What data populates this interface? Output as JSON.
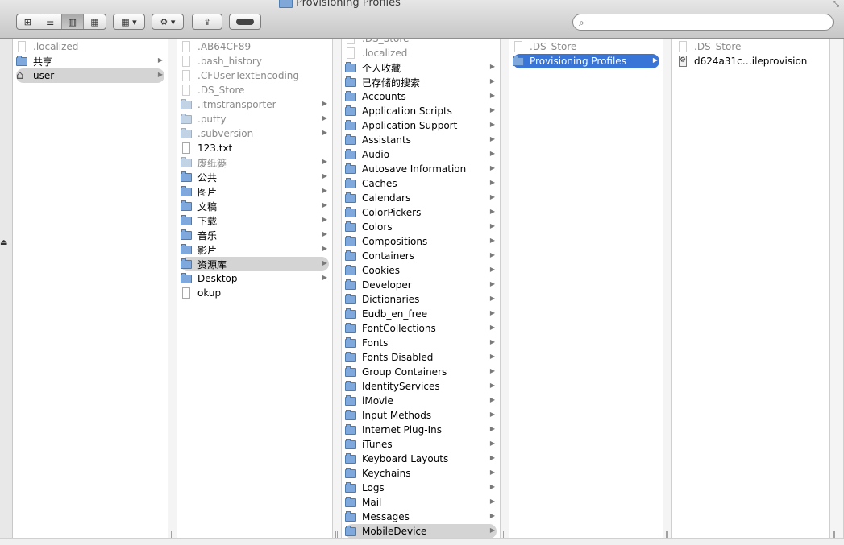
{
  "window": {
    "title": "Provisioning Profiles"
  },
  "toolbar": {
    "view_modes": [
      "icon-view",
      "list-view",
      "column-view",
      "coverflow-view"
    ],
    "active_view": 2,
    "search_placeholder": ""
  },
  "columns": [
    {
      "items": [
        {
          "label": ".localized",
          "kind": "doc",
          "dim": true,
          "arrow": false
        },
        {
          "label": "共享",
          "kind": "folder",
          "dim": false,
          "arrow": true
        },
        {
          "label": "user",
          "kind": "home",
          "dim": false,
          "arrow": true,
          "selected": "gray"
        }
      ]
    },
    {
      "items": [
        {
          "label": ".AB64CF89",
          "kind": "doc",
          "dim": true,
          "arrow": false
        },
        {
          "label": ".bash_history",
          "kind": "doc",
          "dim": true,
          "arrow": false
        },
        {
          "label": ".CFUserTextEncoding",
          "kind": "doc",
          "dim": true,
          "arrow": false
        },
        {
          "label": ".DS_Store",
          "kind": "doc",
          "dim": true,
          "arrow": false
        },
        {
          "label": ".itmstransporter",
          "kind": "folder",
          "dim": true,
          "arrow": true
        },
        {
          "label": ".putty",
          "kind": "folder",
          "dim": true,
          "arrow": true
        },
        {
          "label": ".subversion",
          "kind": "folder",
          "dim": true,
          "arrow": true
        },
        {
          "label": "123.txt",
          "kind": "doc",
          "dim": false,
          "arrow": false
        },
        {
          "label": "废纸篓",
          "kind": "folder",
          "dim": true,
          "arrow": true
        },
        {
          "label": "公共",
          "kind": "folder",
          "dim": false,
          "arrow": true
        },
        {
          "label": "图片",
          "kind": "folder",
          "dim": false,
          "arrow": true
        },
        {
          "label": "文稿",
          "kind": "folder",
          "dim": false,
          "arrow": true
        },
        {
          "label": "下载",
          "kind": "folder",
          "dim": false,
          "arrow": true
        },
        {
          "label": "音乐",
          "kind": "folder",
          "dim": false,
          "arrow": true
        },
        {
          "label": "影片",
          "kind": "folder",
          "dim": false,
          "arrow": true
        },
        {
          "label": "资源库",
          "kind": "folder",
          "dim": false,
          "arrow": true,
          "selected": "gray"
        },
        {
          "label": "Desktop",
          "kind": "folder",
          "dim": false,
          "arrow": true
        },
        {
          "label": "okup",
          "kind": "doc",
          "dim": false,
          "arrow": false
        }
      ]
    },
    {
      "items": [
        {
          "label": ".DS_Store",
          "kind": "doc",
          "dim": true,
          "arrow": false
        },
        {
          "label": ".localized",
          "kind": "doc",
          "dim": true,
          "arrow": false
        },
        {
          "label": "个人收藏",
          "kind": "folder",
          "dim": false,
          "arrow": true
        },
        {
          "label": "已存储的搜索",
          "kind": "folder",
          "dim": false,
          "arrow": true
        },
        {
          "label": "Accounts",
          "kind": "folder",
          "dim": false,
          "arrow": true
        },
        {
          "label": "Application Scripts",
          "kind": "folder",
          "dim": false,
          "arrow": true
        },
        {
          "label": "Application Support",
          "kind": "folder",
          "dim": false,
          "arrow": true
        },
        {
          "label": "Assistants",
          "kind": "folder",
          "dim": false,
          "arrow": true
        },
        {
          "label": "Audio",
          "kind": "folder",
          "dim": false,
          "arrow": true
        },
        {
          "label": "Autosave Information",
          "kind": "folder",
          "dim": false,
          "arrow": true
        },
        {
          "label": "Caches",
          "kind": "folder",
          "dim": false,
          "arrow": true
        },
        {
          "label": "Calendars",
          "kind": "folder",
          "dim": false,
          "arrow": true
        },
        {
          "label": "ColorPickers",
          "kind": "folder",
          "dim": false,
          "arrow": true
        },
        {
          "label": "Colors",
          "kind": "folder",
          "dim": false,
          "arrow": true
        },
        {
          "label": "Compositions",
          "kind": "folder",
          "dim": false,
          "arrow": true
        },
        {
          "label": "Containers",
          "kind": "folder",
          "dim": false,
          "arrow": true
        },
        {
          "label": "Cookies",
          "kind": "folder",
          "dim": false,
          "arrow": true
        },
        {
          "label": "Developer",
          "kind": "folder",
          "dim": false,
          "arrow": true
        },
        {
          "label": "Dictionaries",
          "kind": "folder",
          "dim": false,
          "arrow": true
        },
        {
          "label": "Eudb_en_free",
          "kind": "folder",
          "dim": false,
          "arrow": true
        },
        {
          "label": "FontCollections",
          "kind": "folder",
          "dim": false,
          "arrow": true
        },
        {
          "label": "Fonts",
          "kind": "folder",
          "dim": false,
          "arrow": true
        },
        {
          "label": "Fonts Disabled",
          "kind": "folder",
          "dim": false,
          "arrow": true
        },
        {
          "label": "Group Containers",
          "kind": "folder",
          "dim": false,
          "arrow": true
        },
        {
          "label": "IdentityServices",
          "kind": "folder",
          "dim": false,
          "arrow": true
        },
        {
          "label": "iMovie",
          "kind": "folder",
          "dim": false,
          "arrow": true
        },
        {
          "label": "Input Methods",
          "kind": "folder",
          "dim": false,
          "arrow": true
        },
        {
          "label": "Internet Plug-Ins",
          "kind": "folder",
          "dim": false,
          "arrow": true
        },
        {
          "label": "iTunes",
          "kind": "folder",
          "dim": false,
          "arrow": true
        },
        {
          "label": "Keyboard Layouts",
          "kind": "folder",
          "dim": false,
          "arrow": true
        },
        {
          "label": "Keychains",
          "kind": "folder",
          "dim": false,
          "arrow": true
        },
        {
          "label": "Logs",
          "kind": "folder",
          "dim": false,
          "arrow": true
        },
        {
          "label": "Mail",
          "kind": "folder",
          "dim": false,
          "arrow": true
        },
        {
          "label": "Messages",
          "kind": "folder",
          "dim": false,
          "arrow": true
        },
        {
          "label": "MobileDevice",
          "kind": "folder",
          "dim": false,
          "arrow": true,
          "selected": "gray"
        }
      ]
    },
    {
      "items": [
        {
          "label": ".DS_Store",
          "kind": "doc",
          "dim": true,
          "arrow": false
        },
        {
          "label": "Provisioning Profiles",
          "kind": "folder",
          "dim": false,
          "arrow": true,
          "selected": "blue"
        }
      ]
    },
    {
      "items": [
        {
          "label": ".DS_Store",
          "kind": "doc",
          "dim": true,
          "arrow": false
        },
        {
          "label": "d624a31c…ileprovision",
          "kind": "prov",
          "dim": false,
          "arrow": false
        }
      ]
    }
  ],
  "colors": {
    "selection_blue": "#3875d7",
    "selection_gray": "#d4d4d4",
    "folder_blue": "#7fa9dc"
  }
}
